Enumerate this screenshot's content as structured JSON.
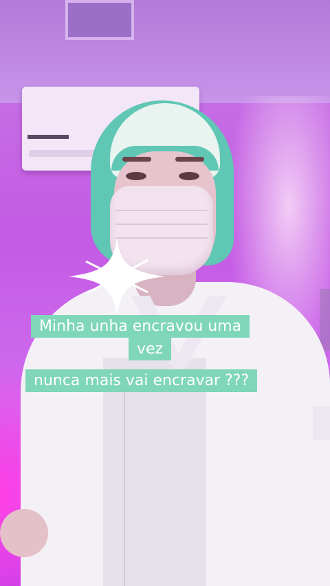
{
  "scene": {
    "description_colors": {
      "wall": "#c45be3",
      "cap": "#5fc7b4",
      "coat": "#f4f1f6",
      "caption_bg": "#7fd6b9"
    }
  },
  "caption": {
    "line1": "Minha unha encravou uma",
    "line2": "vez",
    "line3": "nunca mais vai encravar ???"
  },
  "icons": {
    "sparkle": "sparkle-icon"
  }
}
